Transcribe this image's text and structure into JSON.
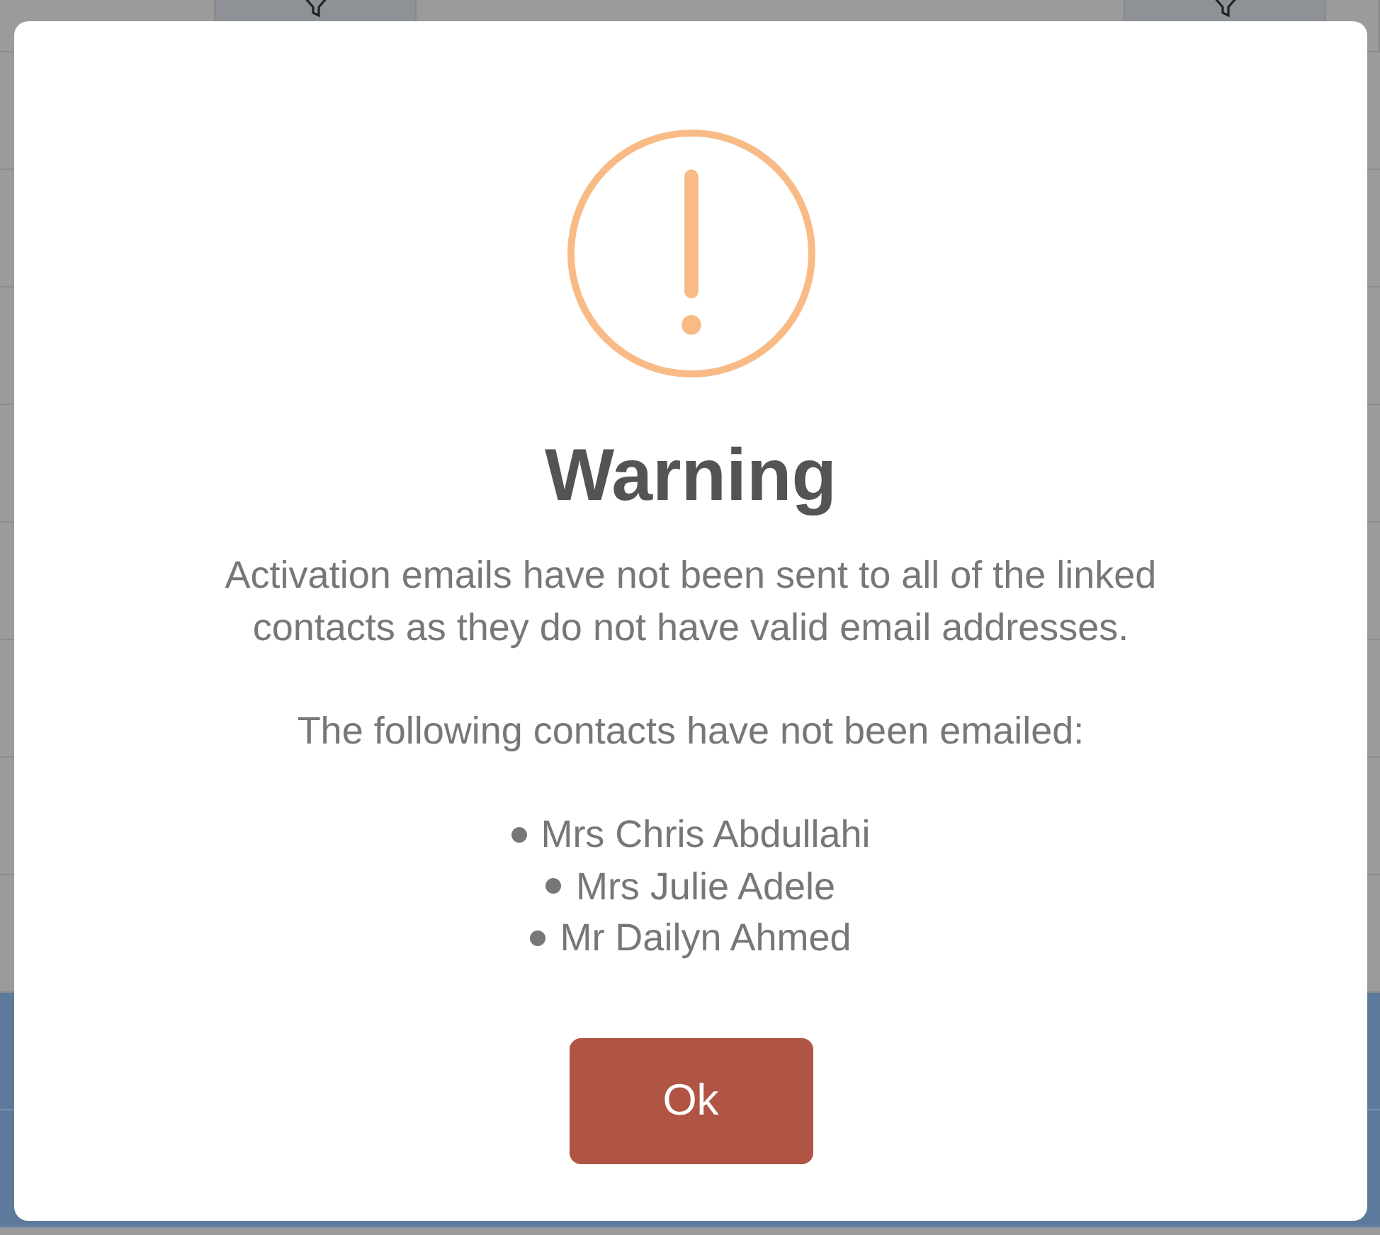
{
  "table": {
    "rows": [
      {
        "selected": false
      },
      {
        "selected": false
      },
      {
        "selected": false
      },
      {
        "selected": false
      },
      {
        "selected": false
      },
      {
        "selected": false
      },
      {
        "selected": false
      },
      {
        "selected": false
      },
      {
        "selected": true
      },
      {
        "selected": true
      }
    ]
  },
  "dialog": {
    "title": "Warning",
    "message": "Activation emails have not been sent to all of the linked contacts as they do not have valid email addresses.",
    "list_intro": "The following contacts have not been emailed:",
    "contacts": [
      "Mrs Chris Abdullahi",
      "Mrs Julie Adele",
      "Mr Dailyn Ahmed"
    ],
    "buttons": [
      "Ok"
    ]
  }
}
